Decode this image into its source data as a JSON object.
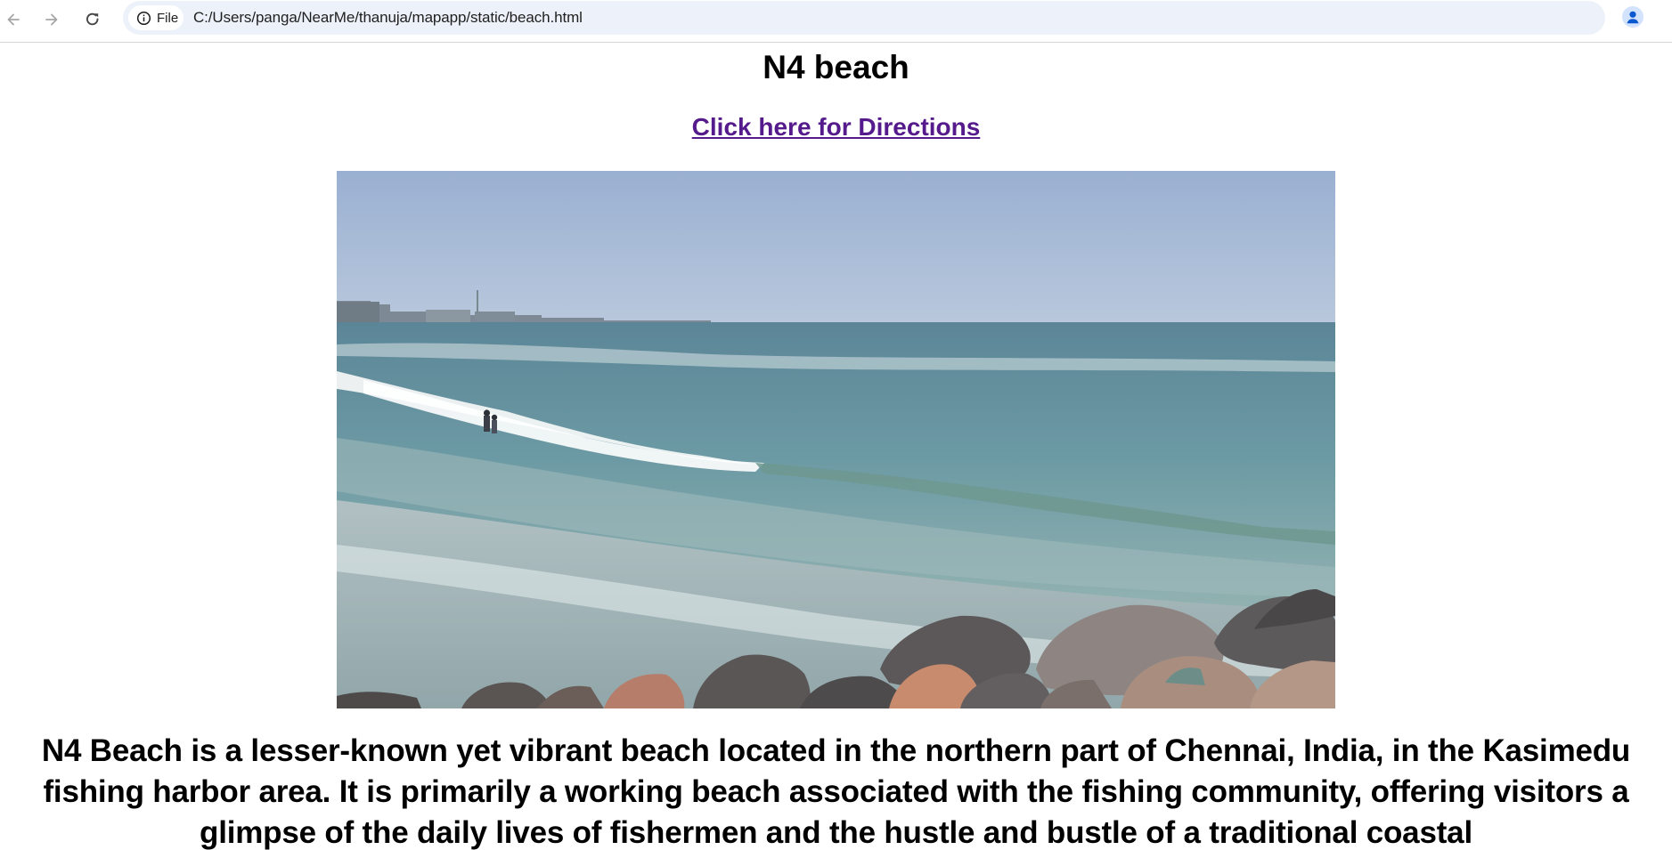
{
  "browser": {
    "chip_label": "File",
    "url": "C:/Users/panga/NearMe/thanuja/mapapp/static/beach.html",
    "icons": {
      "back": "arrow-left-icon",
      "forward": "arrow-right-icon",
      "reload": "reload-icon",
      "site_info": "info-icon",
      "bookmark": "star-icon",
      "profile": "person-icon"
    },
    "accent_color": "#0b57d0"
  },
  "page": {
    "title": "N4 beach",
    "directions_link": "Click here for Directions",
    "link_color": "#551a8b",
    "description": "N4 Beach is a lesser-known yet vibrant beach located in the northern part of Chennai, India, in the Kasimedu fishing harbor area. It is primarily a working beach associated with the fishing community, offering visitors a glimpse of the daily lives of fishermen and the hustle and bustle of a traditional coastal"
  }
}
